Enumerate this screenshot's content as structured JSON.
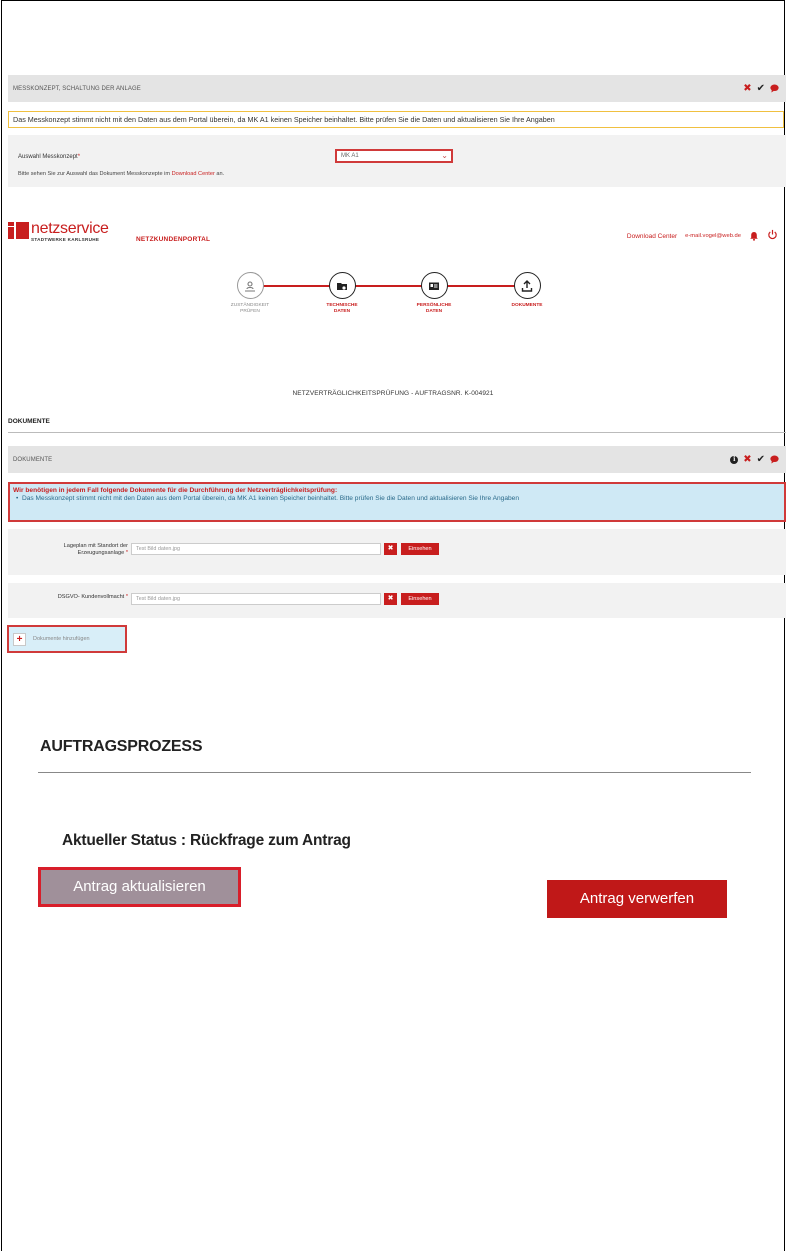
{
  "messkonzept": {
    "section_title": "MESSKONZEPT, SCHALTUNG DER ANLAGE",
    "warning": "Das Messkonzept stimmt nicht mit den Daten aus dem Portal überein, da MK A1 keinen Speicher beinhaltet. Bitte prüfen Sie die Daten und aktualisieren Sie Ihre Angaben",
    "select_label": "Auswahl Messkonzept",
    "required_mark": "*",
    "select_value": "MK A1",
    "hint_prefix": "Bitte sehen Sie zur Auswahl das Dokument Messkonzepte im",
    "hint_link": "Download Center",
    "hint_suffix": "an."
  },
  "header": {
    "logo_main": "netzservice",
    "logo_sub": "STADTWERKE KARLSRUHE",
    "portal_name": "NETZKUNDENPORTAL",
    "download_center": "Download Center",
    "email": "e-mail.vogel@web.de"
  },
  "stepper": {
    "steps": [
      {
        "label_l1": "ZUSTÄNDIGKEIT",
        "label_l2": "PRÜFEN",
        "icon": "location-person-icon"
      },
      {
        "label_l1": "TECHNISCHE",
        "label_l2": "DATEN",
        "icon": "folder-gear-icon"
      },
      {
        "label_l1": "PERSÖNLICHE",
        "label_l2": "DATEN",
        "icon": "id-card-icon"
      },
      {
        "label_l1": "DOKUMENTE",
        "label_l2": "",
        "icon": "upload-icon"
      }
    ]
  },
  "order_title": "NETZVERTRÄGLICHKEITSPRÜFUNG - AUFTRAGSNR. K-004921",
  "documents": {
    "heading": "DOKUMENTE",
    "section_title": "DOKUMENTE",
    "info_title": "Wir benötigen in jedem Fall folgende Dokumente für die Durchführung der Netzverträglichkeitsprüfung:",
    "info_item": "Das Messkonzept stimmt nicht mit den Daten aus dem Portal überein, da MK A1 keinen Speicher beinhaltet. Bitte prüfen Sie die Daten und aktualisieren Sie Ihre Angaben",
    "rows": [
      {
        "label_l1": "Lageplan mit Standort der",
        "label_l2": "Erzeugungsanlage",
        "file": "Test Bild daten.jpg",
        "view": "Einsehen"
      },
      {
        "label_l1": "DSGVO- Kundenvollmacht",
        "label_l2": "",
        "file": "Test Bild daten.jpg",
        "view": "Einsehen"
      }
    ],
    "add_label": "Dokumente hinzufügen"
  },
  "process": {
    "title": "AUFTRAGSPROZESS",
    "status": "Aktueller Status : Rückfrage zum Antrag",
    "update_button": "Antrag aktualisieren",
    "discard_button": "Antrag verwerfen"
  },
  "colors": {
    "brand_red": "#c81e1e",
    "info_blue": "#cfe9f5",
    "warn_yellow": "#f0c040"
  }
}
